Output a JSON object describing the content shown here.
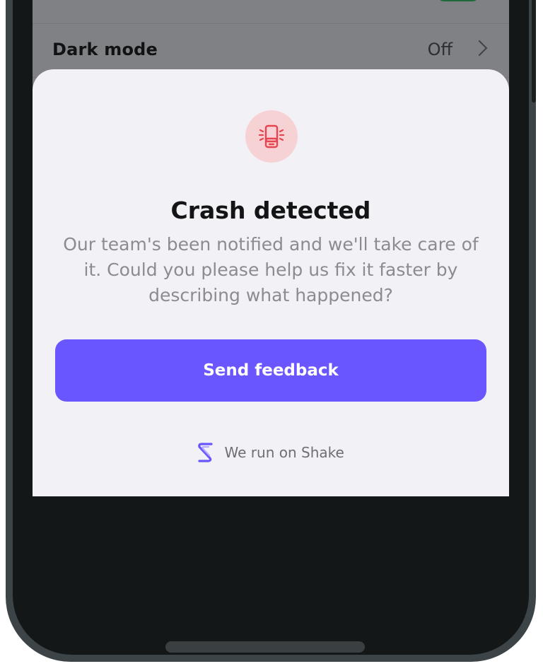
{
  "settings": {
    "dark_mode_label": "Dark mode",
    "dark_mode_value": "Off"
  },
  "dialog": {
    "icon": "crash-phone-icon",
    "title": "Crash detected",
    "description": "Our team's been notified and we'll take care of it. Could you please help us fix it faster by describing what happened?",
    "primary_button": "Send feedback",
    "footer_text": "We run on Shake",
    "footer_icon": "shake-logo-icon"
  },
  "colors": {
    "accent": "#6a56ff",
    "crash_icon": "#e8434e",
    "crash_icon_bg": "#f6d2d4",
    "sheet_bg": "#f2f1f6"
  }
}
